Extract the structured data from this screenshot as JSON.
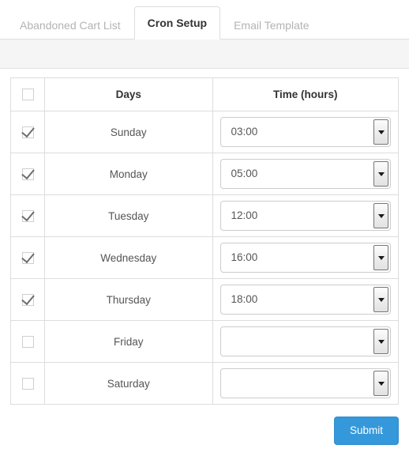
{
  "tabs": [
    {
      "label": "Abandoned Cart List",
      "active": false
    },
    {
      "label": "Cron Setup",
      "active": true
    },
    {
      "label": "Email Template",
      "active": false
    }
  ],
  "table": {
    "headers": {
      "select_all": "",
      "days": "Days",
      "time": "Time (hours)"
    },
    "rows": [
      {
        "day": "Sunday",
        "checked": true,
        "time": "03:00"
      },
      {
        "day": "Monday",
        "checked": true,
        "time": "05:00"
      },
      {
        "day": "Tuesday",
        "checked": true,
        "time": "12:00"
      },
      {
        "day": "Wednesday",
        "checked": true,
        "time": "16:00"
      },
      {
        "day": "Thursday",
        "checked": true,
        "time": "18:00"
      },
      {
        "day": "Friday",
        "checked": false,
        "time": ""
      },
      {
        "day": "Saturday",
        "checked": false,
        "time": ""
      }
    ],
    "select_all_checked": false
  },
  "footer": {
    "submit_label": "Submit"
  },
  "colors": {
    "accent": "#3498db",
    "tab_active_text": "#333333",
    "tab_inactive_text": "#b3b3b3",
    "band_background": "#f5f5f5",
    "border": "#dddddd"
  }
}
